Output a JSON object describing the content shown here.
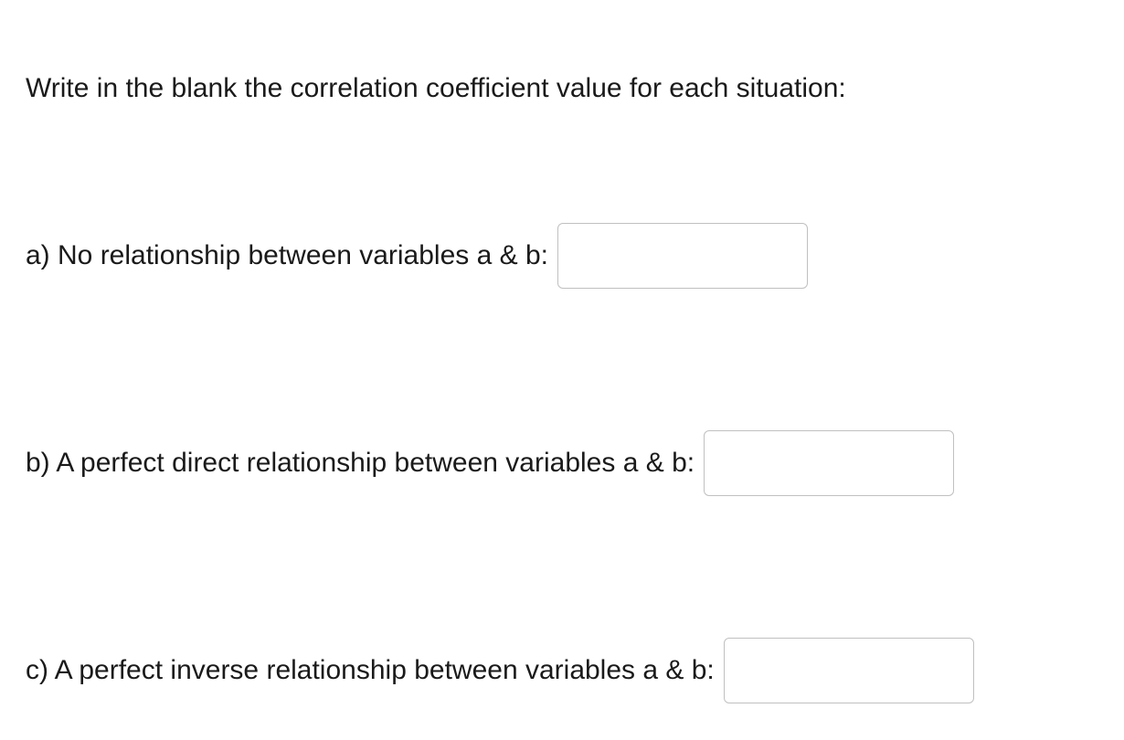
{
  "instruction": "Write in the blank the correlation coefficient value for each situation:",
  "questions": {
    "a": {
      "label": "a) No relationship between variables a & b:",
      "value": ""
    },
    "b": {
      "label": "b) A perfect direct relationship between variables a & b:",
      "value": ""
    },
    "c": {
      "label": "c) A perfect inverse relationship between variables a & b:",
      "value": ""
    }
  }
}
